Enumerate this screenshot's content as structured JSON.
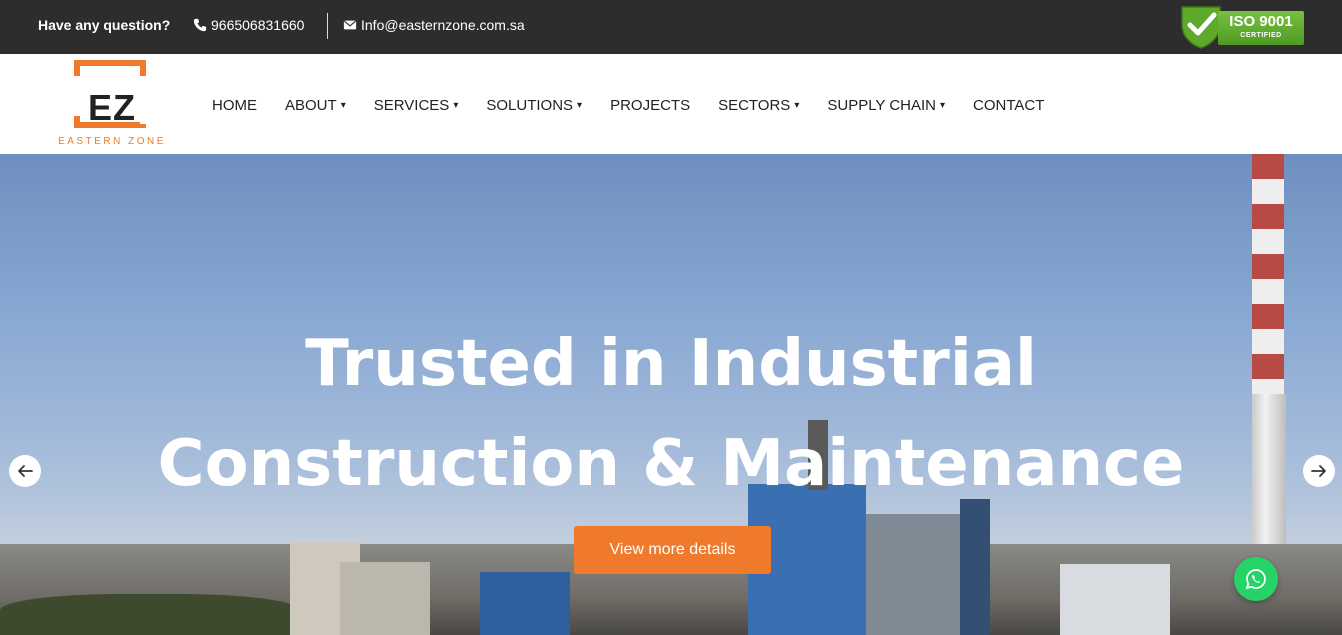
{
  "topbar": {
    "question": "Have any question?",
    "phone": "966506831660",
    "email": "Info@easternzone.com.sa",
    "iso_title": "ISO 9001",
    "iso_sub": "CERTIFIED",
    "icons": [
      "phone-icon",
      "envelope-icon",
      "checkmark-shield-icon"
    ]
  },
  "logo": {
    "mark": "EZ",
    "name": "EASTERN ZONE"
  },
  "nav": {
    "items": [
      {
        "label": "HOME",
        "dropdown": false
      },
      {
        "label": "ABOUT",
        "dropdown": true
      },
      {
        "label": "SERVICES",
        "dropdown": true
      },
      {
        "label": "SOLUTIONS",
        "dropdown": true
      },
      {
        "label": "PROJECTS",
        "dropdown": false
      },
      {
        "label": "SECTORS",
        "dropdown": true
      },
      {
        "label": "SUPPLY CHAIN",
        "dropdown": true
      },
      {
        "label": "CONTACT",
        "dropdown": false
      }
    ],
    "caret": "▾"
  },
  "hero": {
    "line1": "Trusted in Industrial",
    "line2": "Construction & Maintenance",
    "cta": "View more details",
    "icons": [
      "arrow-left-icon",
      "arrow-right-icon",
      "whatsapp-icon"
    ]
  },
  "colors": {
    "topbar_bg": "#2d2d2d",
    "accent": "#f07a2c",
    "whatsapp": "#25d366",
    "iso_green": "#4e9a22"
  }
}
